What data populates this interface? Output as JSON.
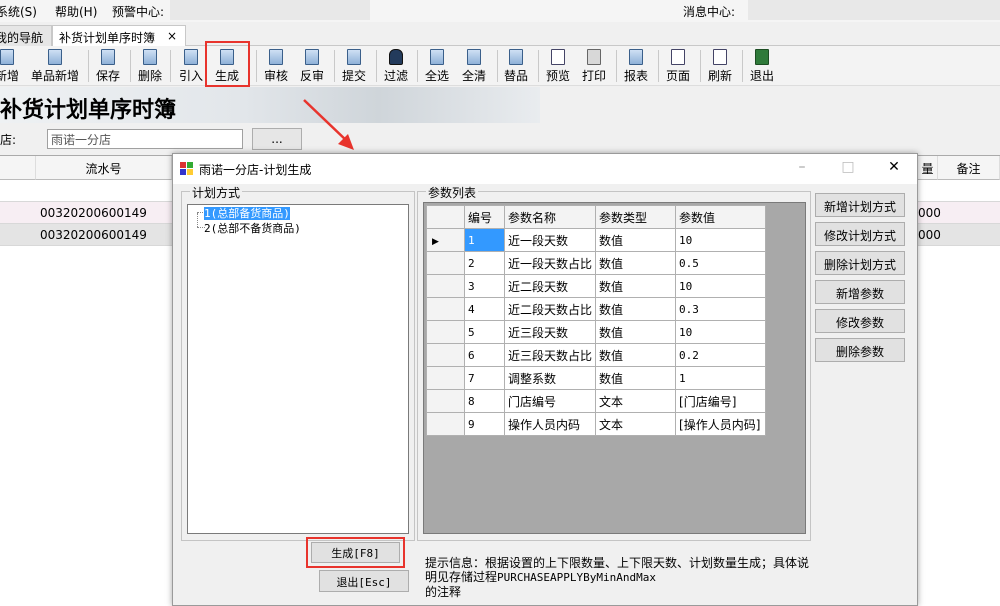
{
  "menu": {
    "system": "系统(S)",
    "help": "帮助(H)",
    "alert_center": "预警中心:",
    "message_center": "消息中心:"
  },
  "tabs": [
    {
      "label": "我的导航"
    },
    {
      "label": "补货计划单序时簿",
      "close": "×"
    }
  ],
  "toolbar": [
    "新增",
    "单品新增",
    "保存",
    "删除",
    "引入",
    "生成",
    "审核",
    "反审",
    "提交",
    "过滤",
    "全选",
    "全清",
    "替品",
    "预览",
    "打印",
    "报表",
    "页面",
    "刷新",
    "退出"
  ],
  "page": {
    "title": "补货计划单序时簿",
    "store_label": "店:",
    "store_value": "雨诺一分店",
    "browse_label": "..."
  },
  "background_grid": {
    "columns": [
      "流水号",
      "量",
      "备注"
    ],
    "rows": [
      {
        "serial": "00320200600149",
        "qty": "000"
      },
      {
        "serial": "00320200600149",
        "qty": "000"
      }
    ]
  },
  "dialog": {
    "title": "雨诺一分店-计划生成",
    "minimize": "–",
    "maximize": "□",
    "close": "✕",
    "plan_group_title": "计划方式",
    "plans": [
      {
        "label": "1(总部备货商品)",
        "selected": true
      },
      {
        "label": "2(总部不备货商品)",
        "selected": false
      }
    ],
    "param_group_title": "参数列表",
    "param_columns": [
      "编号",
      "参数名称",
      "参数类型",
      "参数值"
    ],
    "params": [
      {
        "no": "1",
        "name": "近一段天数",
        "type": "数值",
        "value": "10"
      },
      {
        "no": "2",
        "name": "近一段天数占比",
        "type": "数值",
        "value": "0.5"
      },
      {
        "no": "3",
        "name": "近二段天数",
        "type": "数值",
        "value": "10"
      },
      {
        "no": "4",
        "name": "近二段天数占比",
        "type": "数值",
        "value": "0.3"
      },
      {
        "no": "5",
        "name": "近三段天数",
        "type": "数值",
        "value": "10"
      },
      {
        "no": "6",
        "name": "近三段天数占比",
        "type": "数值",
        "value": "0.2"
      },
      {
        "no": "7",
        "name": "调整系数",
        "type": "数值",
        "value": "1"
      },
      {
        "no": "8",
        "name": "门店编号",
        "type": "文本",
        "value": "[门店编号]"
      },
      {
        "no": "9",
        "name": "操作人员内码",
        "type": "文本",
        "value": "[操作人员内码]"
      }
    ],
    "buttons": {
      "add_plan": "新增计划方式",
      "edit_plan": "修改计划方式",
      "delete_plan": "删除计划方式",
      "add_param": "新增参数",
      "edit_param": "修改参数",
      "delete_param": "删除参数",
      "generate": "生成[F8]",
      "exit": "退出[Esc]"
    },
    "hint_prefix": "提示信息：根据设置的上下限数量、上下限天数、计划数量生成；具体说明见存储过程",
    "hint_code": "PURCHASEAPPLYByMinAndMax",
    "hint_suffix": "的注释"
  }
}
